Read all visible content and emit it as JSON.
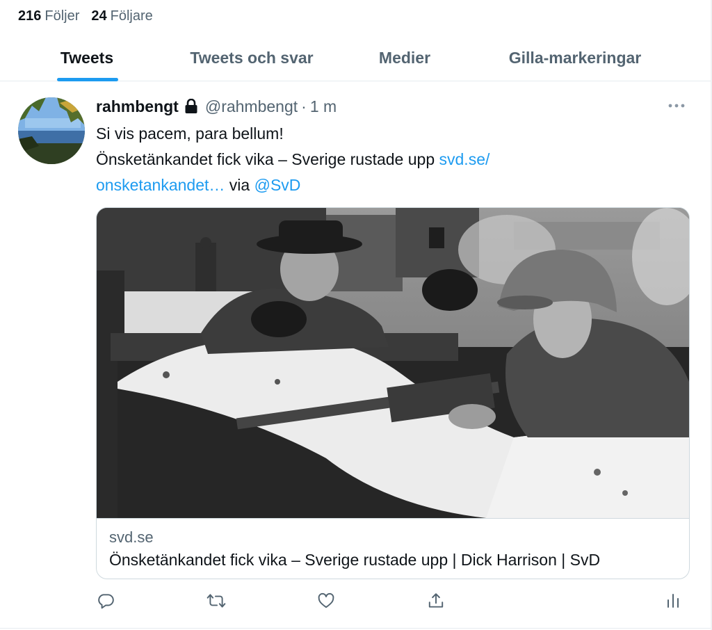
{
  "profile_stats": {
    "following_count": "216",
    "following_label": "Följer",
    "followers_count": "24",
    "followers_label": "Följare"
  },
  "tabs": [
    {
      "label": "Tweets",
      "active": true
    },
    {
      "label": "Tweets och svar",
      "active": false
    },
    {
      "label": "Medier",
      "active": false
    },
    {
      "label": "Gilla-markeringar",
      "active": false
    }
  ],
  "tweet": {
    "display_name": "rahmbengt",
    "protected_icon": "lock-icon",
    "handle": "@rahmbengt",
    "separator": "·",
    "time": "1 m",
    "text_line1": "Si vis pacem, para bellum!",
    "text_line2_prefix": "Önsketänkandet fick vika – Sverige rustade upp ",
    "link_part1": "svd.se/",
    "link_part2": "onsketankandet…",
    "via_text": " via ",
    "mention": "@SvD",
    "card": {
      "domain": "svd.se",
      "title": "Önsketänkandet fick vika – Sverige rustade upp | Dick Harrison | SvD"
    },
    "actions": [
      "reply-icon",
      "retweet-icon",
      "like-icon",
      "share-icon",
      "analytics-icon"
    ]
  },
  "colors": {
    "accent": "#1d9bf0",
    "text_primary": "#0f1419",
    "text_secondary": "#536471",
    "border": "#cfd9de"
  }
}
